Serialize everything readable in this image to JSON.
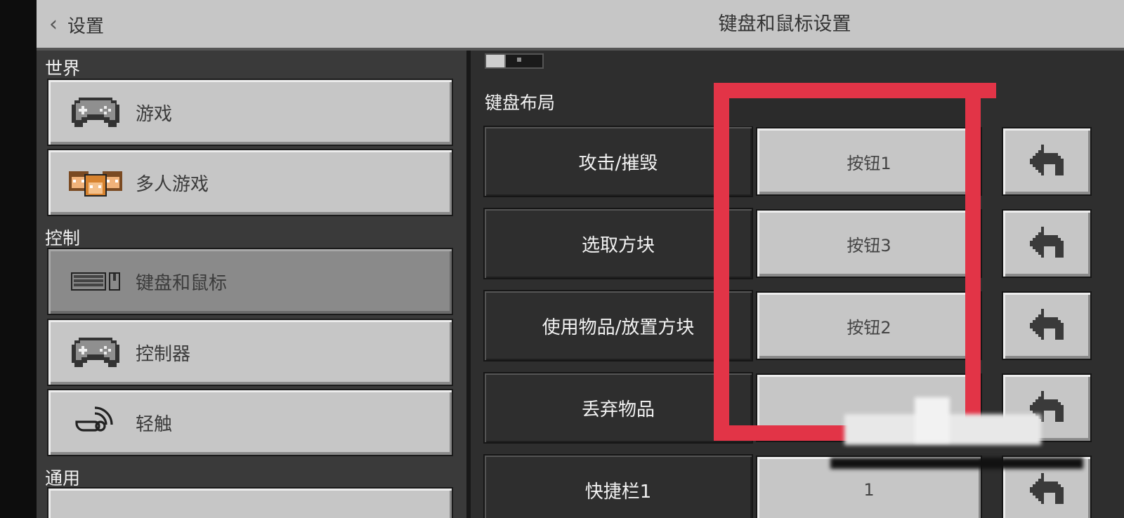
{
  "header": {
    "back_label": "设置",
    "page_title": "键盘和鼠标设置"
  },
  "sidebar": {
    "sections": [
      {
        "title": "世界",
        "items": [
          {
            "label": "游戏",
            "icon": "gamepad-icon"
          },
          {
            "label": "多人游戏",
            "icon": "players-icon"
          }
        ]
      },
      {
        "title": "控制",
        "items": [
          {
            "label": "键盘和鼠标",
            "icon": "keyboard-mouse-icon",
            "active": true
          },
          {
            "label": "控制器",
            "icon": "gamepad-icon"
          },
          {
            "label": "轻触",
            "icon": "touch-icon"
          }
        ]
      },
      {
        "title": "通用",
        "items": []
      }
    ]
  },
  "main": {
    "section_title": "键盘布局",
    "bindings": [
      {
        "action": "攻击/摧毁",
        "key": "按钮1"
      },
      {
        "action": "选取方块",
        "key": "按钮3"
      },
      {
        "action": "使用物品/放置方块",
        "key": "按钮2"
      },
      {
        "action": "丢弃物品",
        "key": ""
      },
      {
        "action": "快捷栏1",
        "key": "1"
      }
    ]
  },
  "colors": {
    "annotation": "#e23447",
    "button_face": "#c6c6c6",
    "panel_dark": "#2e2e2e"
  }
}
